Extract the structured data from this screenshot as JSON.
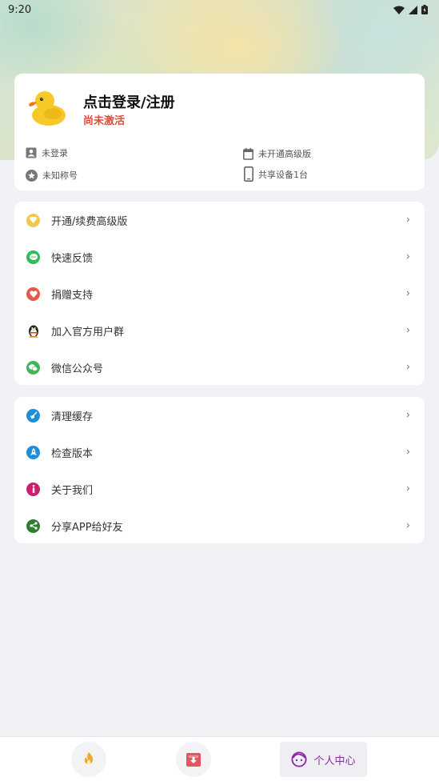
{
  "status_bar": {
    "time": "9:20"
  },
  "profile": {
    "title": "点击登录/注册",
    "subtitle": "尚未激活",
    "info": {
      "login_status": "未登录",
      "title_label": "未知称号",
      "premium_status": "未开通高级版",
      "shared_devices": "共享设备1台"
    }
  },
  "menu_group_1": [
    {
      "label": "开通/续费高级版",
      "icon": "diamond-icon",
      "color": "#f2c94c"
    },
    {
      "label": "快速反馈",
      "icon": "chat-icon",
      "color": "#2ebd59"
    },
    {
      "label": "捐赠支持",
      "icon": "heart-icon",
      "color": "#e8574a"
    },
    {
      "label": "加入官方用户群",
      "icon": "qq-penguin-icon",
      "color": "#222222"
    },
    {
      "label": "微信公众号",
      "icon": "wechat-icon",
      "color": "#3fb65a"
    }
  ],
  "menu_group_2": [
    {
      "label": "清理缓存",
      "icon": "broom-icon",
      "color": "#1d8fd8"
    },
    {
      "label": "检查版本",
      "icon": "rocket-icon",
      "color": "#1d8fd8"
    },
    {
      "label": "关于我们",
      "icon": "info-icon",
      "color": "#d01e6f"
    },
    {
      "label": "分享APP给好友",
      "icon": "share-icon",
      "color": "#2e7d32"
    }
  ],
  "chevron": "›",
  "bottom_nav": {
    "tabs": [
      {
        "name": "hot",
        "icon": "flame-icon"
      },
      {
        "name": "download",
        "icon": "download-box-icon"
      },
      {
        "name": "profile",
        "icon": "face-icon",
        "label": "个人中心",
        "active": true
      }
    ]
  }
}
